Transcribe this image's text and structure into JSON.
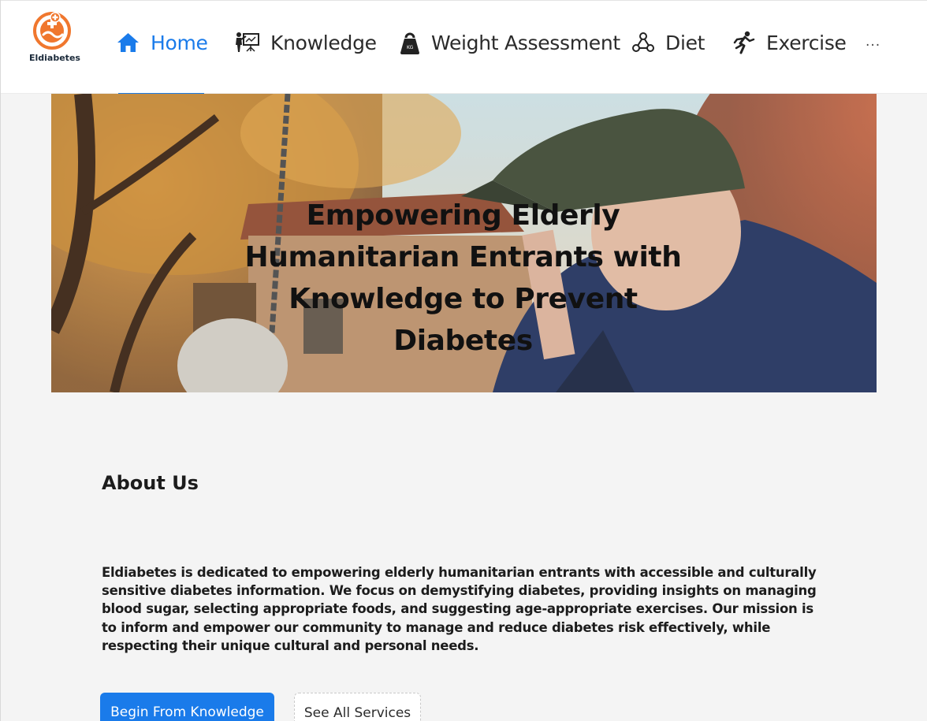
{
  "brand": {
    "name": "Eldiabetes",
    "accent": "#1a7bea",
    "logo_color": "#f0772e"
  },
  "nav": {
    "items": [
      {
        "label": "Home",
        "icon": "home-icon",
        "active": true
      },
      {
        "label": "Knowledge",
        "icon": "teacher-board-icon",
        "active": false
      },
      {
        "label": "Weight Assessment",
        "icon": "kettlebell-weight-icon",
        "active": false
      },
      {
        "label": "Diet",
        "icon": "molecule-nodes-icon",
        "active": false
      },
      {
        "label": "Exercise",
        "icon": "running-person-icon",
        "active": false
      }
    ],
    "more": "..."
  },
  "hero": {
    "title": "Empowering Elderly Humanitarian Entrants with Knowledge to Prevent Diabetes"
  },
  "about": {
    "heading": "About Us",
    "body": "Eldiabetes is dedicated to empowering elderly humanitarian entrants with accessible and culturally sensitive diabetes information. We focus on demystifying diabetes, providing insights on managing blood sugar, selecting appropriate foods, and suggesting age-appropriate exercises. Our mission is to inform and empower our community to manage and reduce diabetes risk effectively, while respecting their unique cultural and personal needs."
  },
  "buttons": {
    "primary": "Begin From Knowledge",
    "secondary": "See All Services"
  }
}
